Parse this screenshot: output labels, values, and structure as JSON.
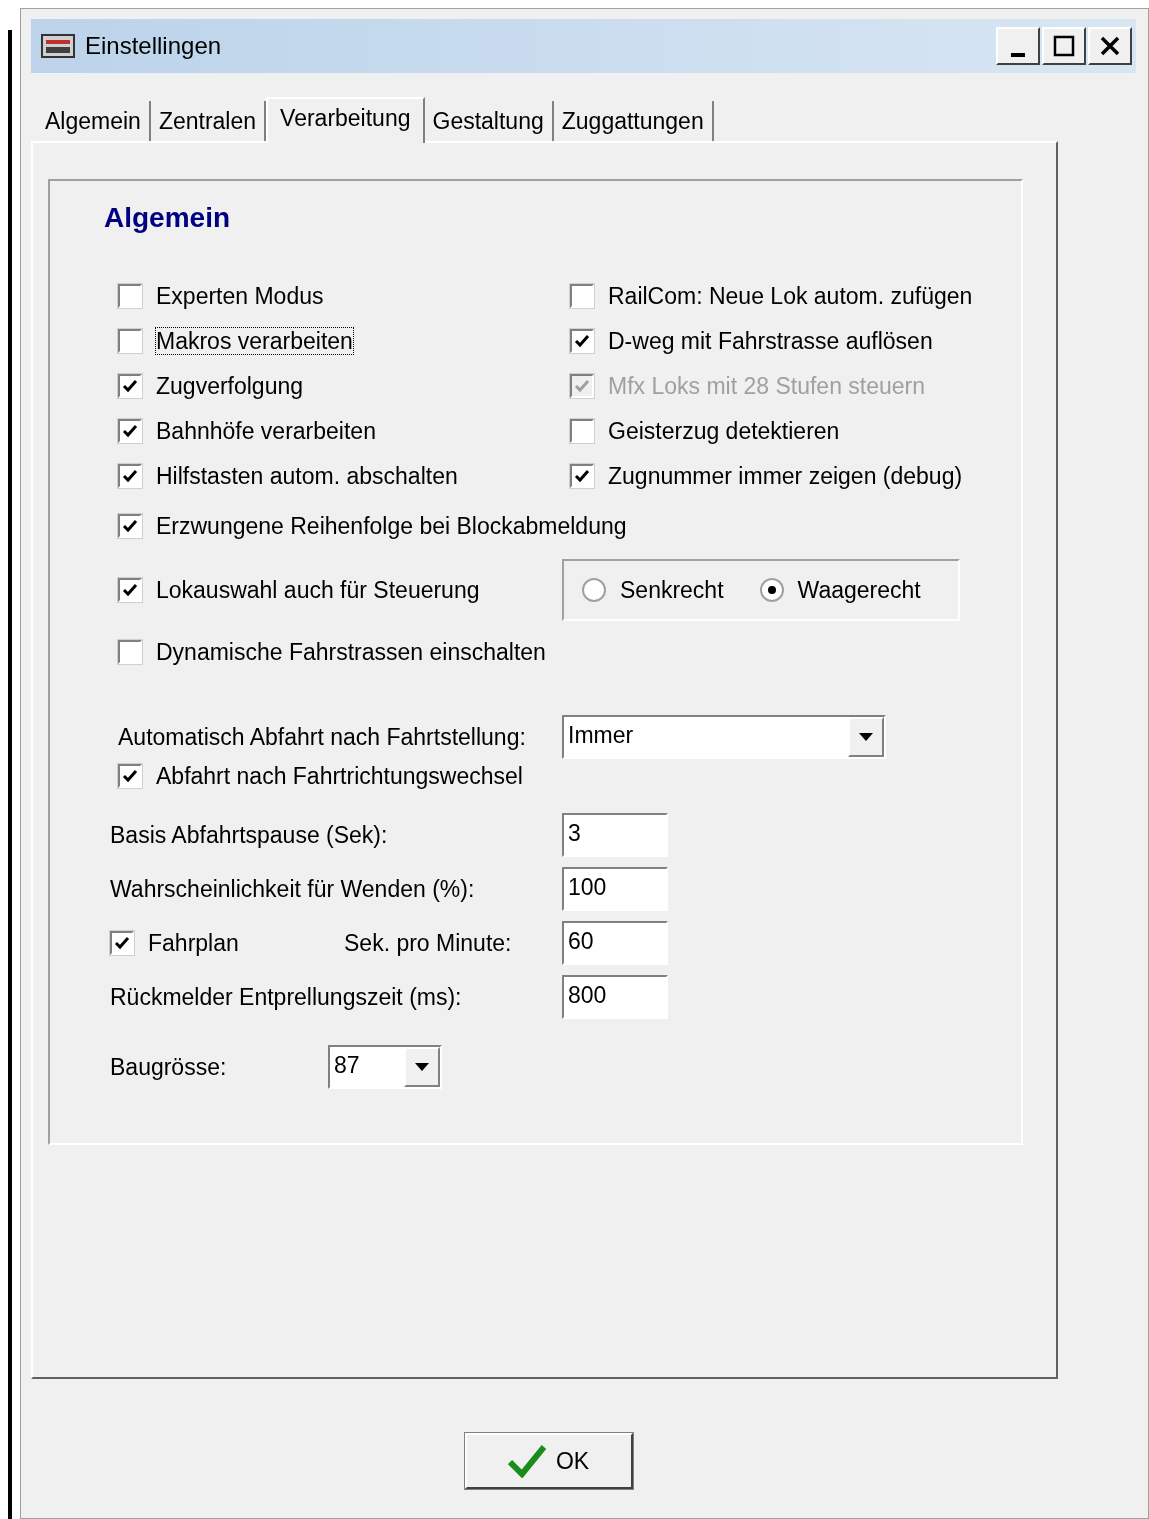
{
  "window": {
    "title": "Einstellingen"
  },
  "tabs": [
    {
      "label": "Algemein",
      "selected": false
    },
    {
      "label": "Zentralen",
      "selected": false
    },
    {
      "label": "Verarbeitung",
      "selected": true
    },
    {
      "label": "Gestaltung",
      "selected": false
    },
    {
      "label": "Zuggattungen",
      "selected": false
    }
  ],
  "group": {
    "title": "Algemein"
  },
  "checkbox_columns": [
    [
      {
        "label": "Experten Modus",
        "checked": false,
        "disabled": false,
        "focused": false
      },
      {
        "label": "Makros verarbeiten",
        "checked": false,
        "disabled": false,
        "focused": true
      },
      {
        "label": "Zugverfolgung",
        "checked": true,
        "disabled": false,
        "focused": false
      },
      {
        "label": "Bahnhöfe verarbeiten",
        "checked": true,
        "disabled": false,
        "focused": false
      },
      {
        "label": "Hilfstasten autom. abschalten",
        "checked": true,
        "disabled": false,
        "focused": false
      }
    ],
    [
      {
        "label": "RailCom: Neue Lok autom. zufügen",
        "checked": false,
        "disabled": false,
        "focused": false
      },
      {
        "label": "D-weg mit Fahrstrasse auflösen",
        "checked": true,
        "disabled": false,
        "focused": false
      },
      {
        "label": "Mfx Loks mit 28 Stufen steuern",
        "checked": true,
        "disabled": true,
        "focused": false
      },
      {
        "label": "Geisterzug detektieren",
        "checked": false,
        "disabled": false,
        "focused": false
      },
      {
        "label": "Zugnummer immer zeigen (debug)",
        "checked": true,
        "disabled": false,
        "focused": false
      }
    ]
  ],
  "forced_order": {
    "label": "Erzwungene Reihenfolge bei Blockabmeldung",
    "checked": true
  },
  "loco_select": {
    "label": "Lokauswahl auch für Steuerung",
    "checked": true
  },
  "orientation": [
    {
      "label": "Senkrecht",
      "selected": false
    },
    {
      "label": "Waagerecht",
      "selected": true
    }
  ],
  "dynamic_routes": {
    "label": "Dynamische Fahrstrassen einschalten",
    "checked": false
  },
  "departure": {
    "label": "Automatisch Abfahrt nach Fahrtstellung:",
    "value": "Immer"
  },
  "after_reverse": {
    "label": "Abfahrt nach Fahrtrichtungswechsel",
    "checked": true
  },
  "fields": [
    {
      "kind": "text",
      "label": "Basis Abfahrtspause (Sek):",
      "value": "3"
    },
    {
      "kind": "text",
      "label": "Wahrscheinlichkeit für Wenden (%):",
      "value": "100"
    },
    {
      "kind": "checkbox",
      "label": "Fahrplan",
      "checked": true,
      "sublabel": "Sek. pro Minute:",
      "value": "60"
    },
    {
      "kind": "text",
      "label": "Rückmelder Entprellungszeit (ms):",
      "value": "800"
    }
  ],
  "scale": {
    "label": "Baugrösse:",
    "value": "87"
  },
  "ok_button": {
    "label": "OK"
  }
}
